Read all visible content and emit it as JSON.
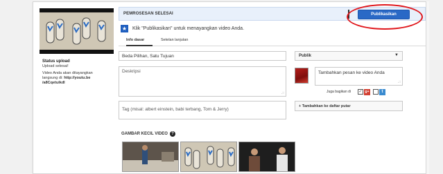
{
  "header": {
    "status_label": "PEMROSESAN SELESAI",
    "publish_label": "Publikasikan"
  },
  "info": {
    "message": "Klik \"Publikasikan\" untuk menayangkan video Anda."
  },
  "tabs": [
    {
      "label": "Info dasar",
      "active": true
    },
    {
      "label": "Setelan lanjutan",
      "active": false
    }
  ],
  "sidebar": {
    "status_title": "Status upload",
    "status_text": "Upload selesai!",
    "live_text_1": "Video Anda akan ditayangkan",
    "live_text_2": "langsung di:",
    "live_link_1": "http://youtu.be",
    "live_link_2": "/a8Cqetuikdl"
  },
  "form": {
    "title_value": "Beda Pilihan, Satu Tujuan",
    "description_placeholder": "Deskripsi",
    "tags_placeholder": "Tag (misal: albert einstein, babi terbang, Tom & Jerry)",
    "privacy_value": "Publik",
    "message_placeholder": "Tambahkan pesan ke video Anda",
    "share_label": "Juga bagikan di",
    "playlist_label": "+ Tambahkan ke daftar putar"
  },
  "thumbnails": {
    "title": "GAMBAR KECIL VIDEO"
  },
  "colors": {
    "accent": "#2a69c6",
    "highlight": "#e0161b",
    "header_bg": "#e8f0fb"
  }
}
